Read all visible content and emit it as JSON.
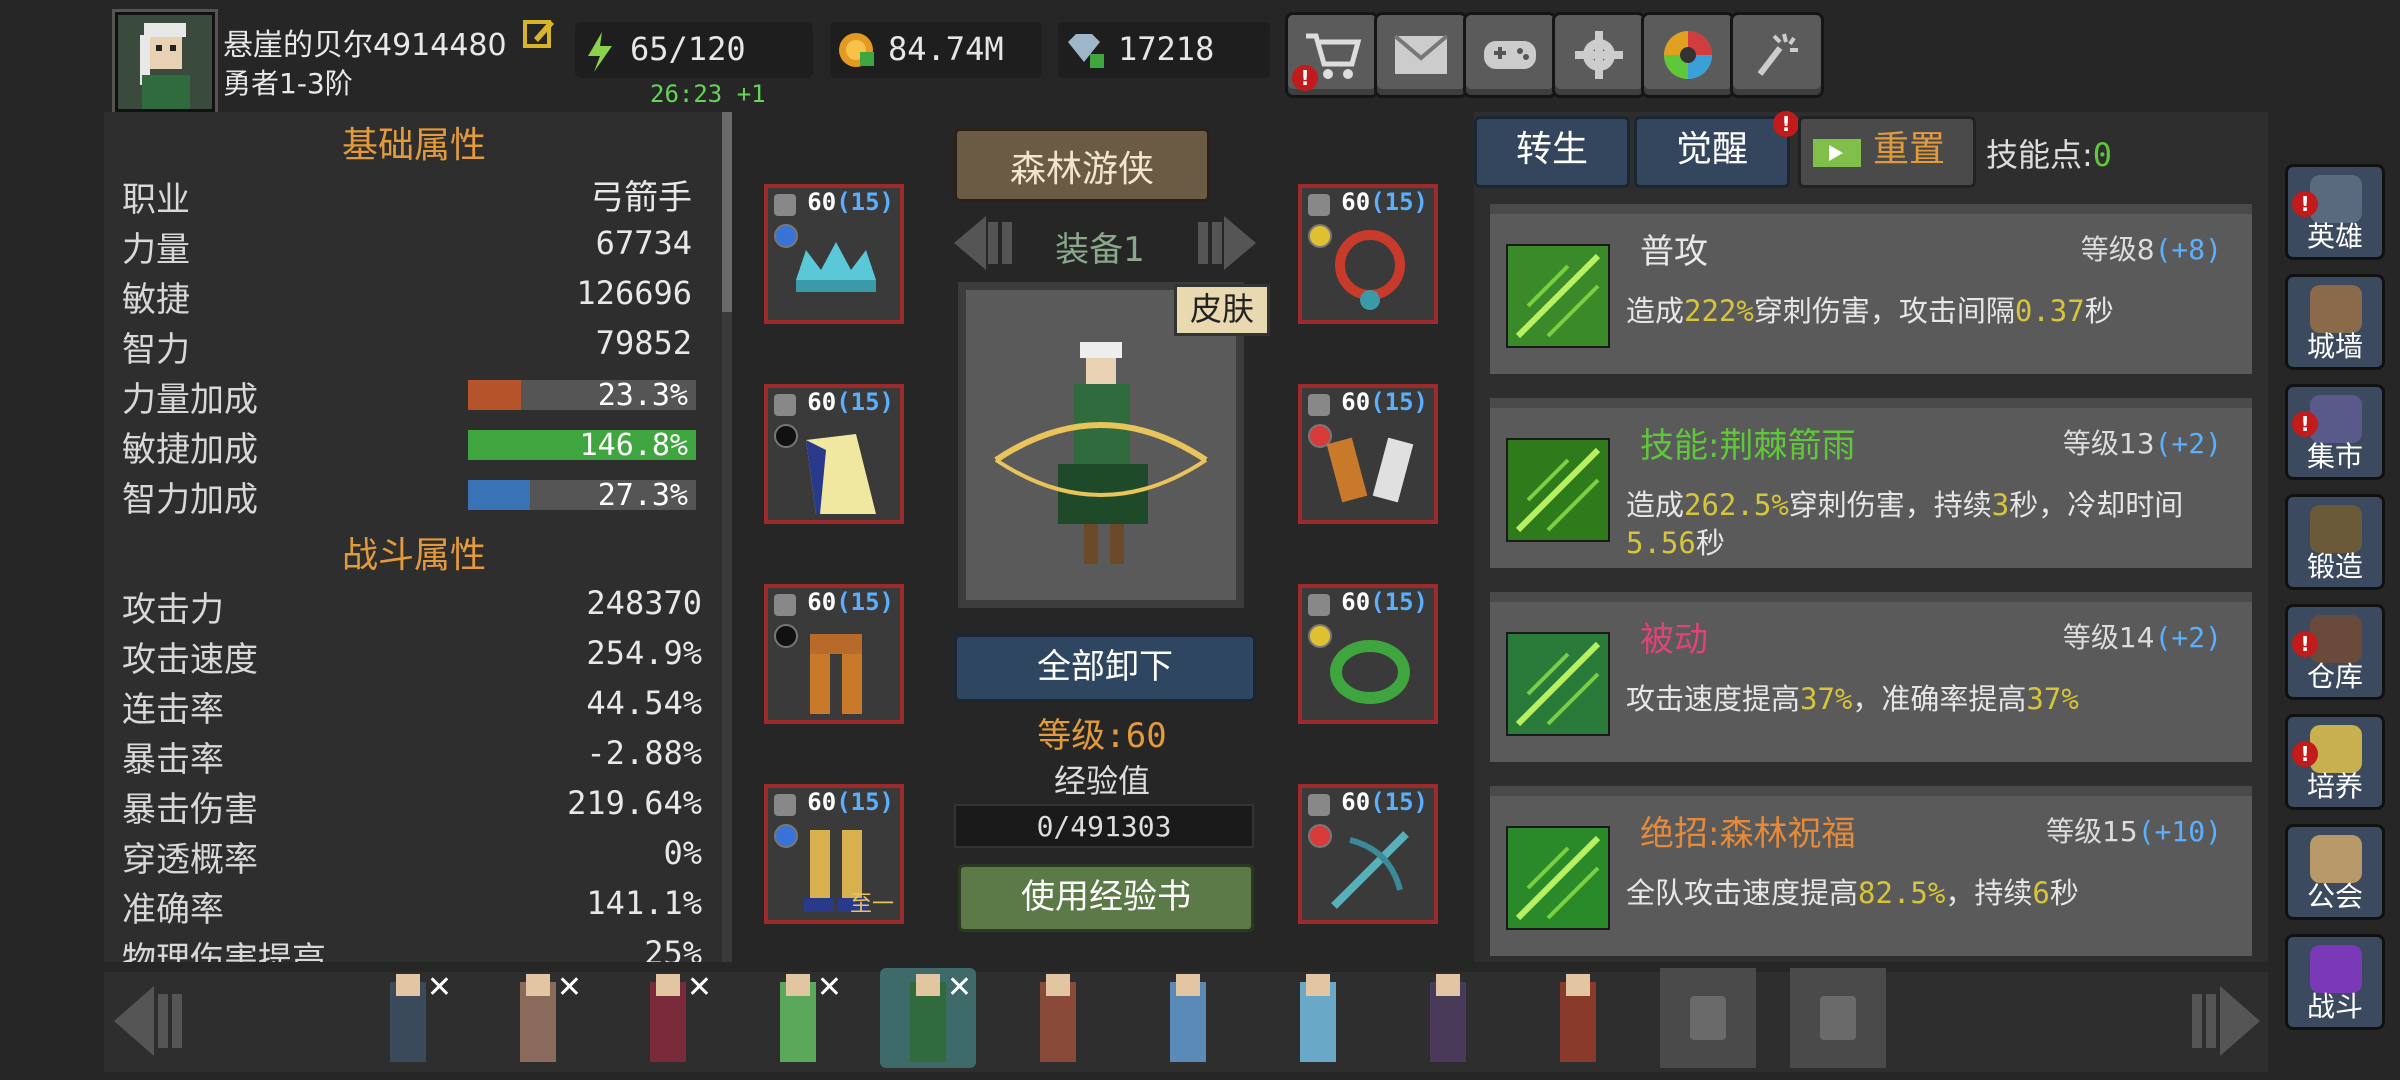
{
  "player": {
    "name": "悬崖的贝尔4914480",
    "rank": "勇者1-3阶"
  },
  "resources": {
    "energy": "65/120",
    "energy_timer": "26:23 +1",
    "gold": "84.74M",
    "diamonds": "17218"
  },
  "top_buttons": [
    {
      "icon": "cart-icon",
      "alert": true
    },
    {
      "icon": "mail-icon",
      "alert": false
    },
    {
      "icon": "gamepad-icon",
      "alert": false
    },
    {
      "icon": "gear-icon",
      "alert": false
    },
    {
      "icon": "color-wheel-icon",
      "alert": false
    },
    {
      "icon": "fireworks-icon",
      "alert": false
    }
  ],
  "basic": {
    "title": "基础属性",
    "class_label": "职业",
    "class_value": "弓箭手",
    "str_label": "力量",
    "str_value": "67734",
    "agi_label": "敏捷",
    "agi_value": "126696",
    "int_label": "智力",
    "int_value": "79852",
    "str_bonus_label": "力量加成",
    "str_bonus": "23.3%",
    "str_bonus_pct": 0.233,
    "str_color": "#b5542a",
    "agi_bonus_label": "敏捷加成",
    "agi_bonus": "146.8%",
    "agi_bonus_pct": 1.0,
    "agi_color": "#3fa63f",
    "int_bonus_label": "智力加成",
    "int_bonus": "27.3%",
    "int_bonus_pct": 0.273,
    "int_color": "#3a73b5"
  },
  "combat": {
    "title": "战斗属性",
    "rows": [
      {
        "label": "攻击力",
        "value": "248370"
      },
      {
        "label": "攻击速度",
        "value": "254.9%"
      },
      {
        "label": "连击率",
        "value": "44.54%"
      },
      {
        "label": "暴击率",
        "value": "-2.88%"
      },
      {
        "label": "暴击伤害",
        "value": "219.64%"
      },
      {
        "label": "穿透概率",
        "value": "0%"
      },
      {
        "label": "准确率",
        "value": "141.1%"
      },
      {
        "label": "物理伤害提高",
        "value": "25%"
      }
    ]
  },
  "equipment": {
    "title": "森林游侠",
    "set_label": "装备1",
    "skin_label": "皮肤",
    "unequip_all": "全部卸下",
    "level_text": "等级:60",
    "exp_label": "经验值",
    "exp_value": "0/491303",
    "exp_pct": 0,
    "use_exp_book": "使用经验书",
    "slots": [
      {
        "level": "60",
        "plus": "(15)",
        "item": "crown"
      },
      {
        "level": "60",
        "plus": "(15)",
        "item": "cloak"
      },
      {
        "level": "60",
        "plus": "(15)",
        "item": "pants"
      },
      {
        "level": "60",
        "plus": "(15)",
        "item": "boots",
        "tag": "至一"
      },
      {
        "level": "60",
        "plus": "(15)",
        "item": "necklace"
      },
      {
        "level": "60",
        "plus": "(15)",
        "item": "bracers"
      },
      {
        "level": "60",
        "plus": "(15)",
        "item": "ring"
      },
      {
        "level": "60",
        "plus": "(15)",
        "item": "crossbow"
      }
    ]
  },
  "skill_tabs": {
    "rebirth": "转生",
    "awaken": "觉醒",
    "reset": "重置",
    "points_label": "技能点:",
    "points_value": "0"
  },
  "skills": [
    {
      "name": "普攻",
      "name_color": "#e8e8e8",
      "level": "等级8",
      "bonus": "(+8)",
      "d1": "造成",
      "h1": "222%",
      "d2": "穿刺伤害，攻击间隔",
      "h2": "0.37",
      "d3": "秒",
      "h3": "",
      "d4": ""
    },
    {
      "name": "技能:荆棘箭雨",
      "name_color": "#5fc83a",
      "level": "等级13",
      "bonus": "(+2)",
      "d1": "造成",
      "h1": "262.5%",
      "d2": "穿刺伤害，持续",
      "h2": "3",
      "d3": "秒，冷却时间",
      "h3": "5.56",
      "d4": "秒"
    },
    {
      "name": "被动",
      "name_color": "#e0427a",
      "level": "等级14",
      "bonus": "(+2)",
      "d1": "攻击速度提高",
      "h1": "37%",
      "d2": "，准确率提高",
      "h2": "37%",
      "d3": "",
      "h3": "",
      "d4": ""
    },
    {
      "name": "绝招:森林祝福",
      "name_color": "#e58a3a",
      "level": "等级15",
      "bonus": "(+10)",
      "d1": "全队攻击速度提高",
      "h1": "82.5%",
      "d2": "，持续",
      "h2": "6",
      "d3": "秒",
      "h3": "",
      "d4": ""
    }
  ],
  "right_nav": [
    {
      "label": "英雄",
      "alert": true
    },
    {
      "label": "城墙",
      "alert": false
    },
    {
      "label": "集市",
      "alert": true
    },
    {
      "label": "锻造",
      "alert": false
    },
    {
      "label": "仓库",
      "alert": true
    },
    {
      "label": "培养",
      "alert": true
    },
    {
      "label": "公会",
      "alert": false
    },
    {
      "label": "战斗",
      "alert": false
    }
  ],
  "heroes_count": 12
}
